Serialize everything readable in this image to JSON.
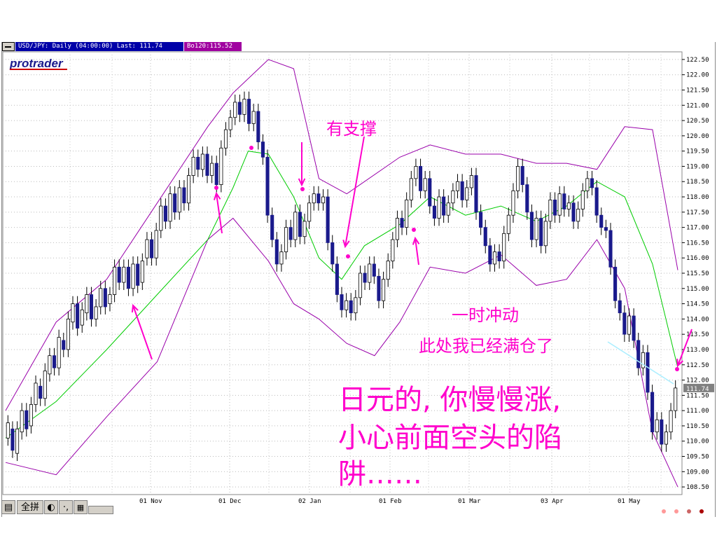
{
  "window": {
    "symbol_info": "USD/JPY: Daily (04:00:00) Last: 111.74",
    "indicator_info": "Bo120:115.52",
    "logo": "protrader",
    "last_price_tag": "111.74"
  },
  "annotations": {
    "support": "有支撑",
    "impulse_line1": "一时冲动",
    "impulse_line2": "此处我已经满仓了",
    "main_line1": "日元的, 你慢慢涨,",
    "main_line2": "小心前面空头的陷",
    "main_line3": "阱……"
  },
  "statusbar": {
    "ime_label": "全拼",
    "moon_icon": "moon-icon",
    "punct_label": "·,",
    "keyboard_icon": "keyboard-icon"
  },
  "colors": {
    "up_candle": "#ffffff",
    "down_candle": "#1a1a8c",
    "middle_band": "#00cc00",
    "outer_bands": "#9900aa",
    "annotation": "#ff00cc",
    "arrow_cyan": "#aaeeff"
  },
  "chart_data": {
    "type": "candlestick",
    "title": "USD/JPY: Daily (04:00:00) Last: 111.74",
    "indicator": "Bollinger Bands (Bo120)",
    "y_ticks": [
      "122.50",
      "122.00",
      "121.50",
      "121.00",
      "120.50",
      "120.00",
      "119.50",
      "119.00",
      "118.50",
      "118.00",
      "117.50",
      "117.00",
      "116.50",
      "116.00",
      "115.50",
      "115.00",
      "114.50",
      "114.00",
      "113.50",
      "113.00",
      "112.50",
      "112.00",
      "111.50",
      "111.00",
      "110.50",
      "110.00",
      "109.50",
      "109.00",
      "108.50"
    ],
    "ylim": [
      108.25,
      122.75
    ],
    "x_ticks": [
      "01 Nov",
      "01 Dec",
      "02 Jan",
      "01 Feb",
      "01 Mar",
      "03 Apr",
      "01 May"
    ],
    "last": 111.74,
    "middle_band": [
      [
        0,
        110.1
      ],
      [
        20,
        111.3
      ],
      [
        40,
        113.0
      ],
      [
        60,
        114.8
      ],
      [
        80,
        116.6
      ],
      [
        90,
        118.3
      ],
      [
        96,
        119.5
      ],
      [
        104,
        119.4
      ],
      [
        114,
        118.0
      ],
      [
        124,
        116.0
      ],
      [
        133,
        115.3
      ],
      [
        142,
        116.4
      ],
      [
        156,
        117.1
      ],
      [
        168,
        118.0
      ],
      [
        182,
        117.4
      ],
      [
        196,
        117.7
      ],
      [
        210,
        117.2
      ],
      [
        222,
        117.7
      ],
      [
        234,
        118.5
      ],
      [
        245,
        118.0
      ],
      [
        256,
        115.8
      ],
      [
        266,
        112.4
      ]
    ],
    "upper_band": [
      [
        0,
        111.0
      ],
      [
        20,
        113.9
      ],
      [
        40,
        115.3
      ],
      [
        60,
        117.8
      ],
      [
        80,
        120.3
      ],
      [
        90,
        121.4
      ],
      [
        104,
        122.5
      ],
      [
        114,
        122.2
      ],
      [
        124,
        118.6
      ],
      [
        135,
        118.1
      ],
      [
        156,
        119.3
      ],
      [
        168,
        119.7
      ],
      [
        182,
        119.4
      ],
      [
        196,
        119.4
      ],
      [
        210,
        119.1
      ],
      [
        222,
        119.1
      ],
      [
        234,
        118.9
      ],
      [
        245,
        120.3
      ],
      [
        256,
        120.2
      ],
      [
        266,
        115.6
      ]
    ],
    "lower_band": [
      [
        0,
        109.3
      ],
      [
        20,
        108.9
      ],
      [
        40,
        110.8
      ],
      [
        60,
        112.6
      ],
      [
        80,
        116.6
      ],
      [
        90,
        117.3
      ],
      [
        104,
        115.9
      ],
      [
        114,
        114.5
      ],
      [
        124,
        114.0
      ],
      [
        135,
        113.2
      ],
      [
        146,
        112.8
      ],
      [
        156,
        113.9
      ],
      [
        168,
        115.7
      ],
      [
        182,
        115.5
      ],
      [
        196,
        116.1
      ],
      [
        210,
        115.1
      ],
      [
        222,
        115.3
      ],
      [
        234,
        116.6
      ],
      [
        245,
        115.0
      ],
      [
        256,
        110.3
      ],
      [
        266,
        108.5
      ]
    ],
    "candles": [
      [
        110.1,
        110.6
      ],
      [
        110.4,
        109.7
      ],
      [
        109.6,
        110.4
      ],
      [
        110.3,
        111.0
      ],
      [
        111.0,
        110.4
      ],
      [
        110.5,
        111.2
      ],
      [
        111.2,
        111.9
      ],
      [
        111.8,
        111.4
      ],
      [
        111.4,
        112.3
      ],
      [
        112.2,
        112.8
      ],
      [
        112.8,
        112.4
      ],
      [
        112.4,
        113.4
      ],
      [
        113.3,
        113.0
      ],
      [
        113.0,
        114.0
      ],
      [
        113.9,
        114.5
      ],
      [
        114.5,
        113.7
      ],
      [
        113.8,
        114.3
      ],
      [
        114.2,
        114.8
      ],
      [
        114.8,
        114.0
      ],
      [
        114.0,
        114.4
      ],
      [
        114.4,
        115.0
      ],
      [
        115.0,
        114.4
      ],
      [
        114.5,
        114.8
      ],
      [
        114.8,
        115.7
      ],
      [
        115.7,
        115.2
      ],
      [
        115.2,
        115.7
      ],
      [
        115.7,
        115.0
      ],
      [
        115.0,
        115.8
      ],
      [
        115.8,
        115.1
      ],
      [
        115.2,
        115.9
      ],
      [
        116.0,
        116.6
      ],
      [
        116.6,
        116.0
      ],
      [
        116.0,
        116.9
      ],
      [
        116.9,
        117.7
      ],
      [
        117.7,
        117.2
      ],
      [
        117.2,
        118.1
      ],
      [
        118.1,
        117.5
      ],
      [
        117.5,
        118.3
      ],
      [
        118.3,
        117.8
      ],
      [
        117.8,
        118.7
      ],
      [
        118.7,
        119.3
      ],
      [
        119.3,
        118.9
      ],
      [
        118.9,
        119.4
      ],
      [
        119.4,
        118.7
      ],
      [
        118.7,
        119.1
      ],
      [
        119.1,
        118.4
      ],
      [
        118.4,
        119.6
      ],
      [
        119.6,
        120.2
      ],
      [
        120.2,
        120.6
      ],
      [
        120.6,
        121.1
      ],
      [
        121.1,
        120.7
      ],
      [
        120.7,
        121.2
      ],
      [
        121.2,
        120.4
      ],
      [
        120.4,
        120.8
      ],
      [
        120.8,
        119.8
      ],
      [
        119.8,
        119.3
      ],
      [
        119.3,
        117.4
      ],
      [
        117.4,
        116.6
      ],
      [
        116.6,
        115.8
      ],
      [
        115.8,
        116.2
      ],
      [
        116.2,
        117.0
      ],
      [
        117.0,
        116.6
      ],
      [
        116.6,
        117.5
      ],
      [
        117.5,
        116.7
      ],
      [
        116.7,
        117.2
      ],
      [
        117.2,
        117.8
      ],
      [
        117.8,
        118.1
      ],
      [
        118.1,
        117.8
      ],
      [
        117.8,
        118.0
      ],
      [
        118.0,
        116.5
      ],
      [
        116.5,
        115.8
      ],
      [
        115.8,
        114.8
      ],
      [
        114.8,
        114.3
      ],
      [
        114.3,
        114.6
      ],
      [
        114.6,
        114.2
      ],
      [
        114.2,
        114.7
      ],
      [
        114.7,
        115.5
      ],
      [
        115.5,
        115.2
      ],
      [
        115.2,
        115.8
      ],
      [
        115.8,
        115.4
      ],
      [
        115.4,
        114.6
      ],
      [
        114.6,
        115.3
      ],
      [
        115.3,
        115.9
      ],
      [
        115.9,
        116.6
      ],
      [
        116.6,
        117.3
      ],
      [
        117.3,
        117.0
      ],
      [
        117.0,
        117.9
      ],
      [
        117.9,
        118.6
      ],
      [
        118.6,
        119.0
      ],
      [
        119.0,
        118.2
      ],
      [
        118.2,
        118.6
      ],
      [
        118.6,
        117.7
      ],
      [
        117.7,
        117.3
      ],
      [
        117.3,
        118.0
      ],
      [
        118.0,
        117.4
      ],
      [
        117.4,
        117.8
      ],
      [
        117.8,
        118.2
      ],
      [
        118.2,
        118.5
      ],
      [
        118.5,
        117.9
      ],
      [
        117.9,
        118.3
      ],
      [
        118.3,
        118.7
      ],
      [
        118.7,
        117.5
      ],
      [
        117.5,
        117.0
      ],
      [
        117.0,
        116.4
      ],
      [
        116.4,
        115.8
      ],
      [
        115.8,
        116.2
      ],
      [
        116.2,
        115.9
      ],
      [
        115.9,
        116.8
      ],
      [
        116.8,
        117.4
      ],
      [
        117.4,
        118.2
      ],
      [
        118.2,
        119.0
      ],
      [
        119.0,
        118.4
      ],
      [
        118.4,
        117.5
      ],
      [
        117.5,
        116.6
      ],
      [
        116.6,
        117.3
      ],
      [
        117.3,
        116.4
      ],
      [
        116.4,
        117.2
      ],
      [
        117.2,
        117.9
      ],
      [
        117.9,
        117.4
      ],
      [
        117.4,
        118.1
      ],
      [
        118.1,
        117.6
      ],
      [
        117.6,
        117.8
      ],
      [
        117.8,
        117.2
      ],
      [
        117.2,
        117.6
      ],
      [
        117.6,
        118.2
      ],
      [
        118.2,
        118.6
      ],
      [
        118.6,
        118.3
      ],
      [
        118.3,
        117.4
      ],
      [
        117.4,
        117.0
      ],
      [
        117.0,
        116.9
      ],
      [
        116.9,
        115.7
      ],
      [
        115.7,
        114.6
      ],
      [
        114.6,
        114.2
      ],
      [
        114.2,
        113.5
      ],
      [
        113.5,
        114.1
      ],
      [
        114.1,
        113.3
      ],
      [
        113.3,
        112.4
      ],
      [
        112.4,
        112.9
      ],
      [
        112.9,
        111.6
      ],
      [
        111.6,
        110.3
      ],
      [
        110.3,
        110.7
      ],
      [
        110.7,
        109.9
      ],
      [
        109.9,
        110.3
      ],
      [
        110.3,
        111.0
      ],
      [
        111.0,
        111.74
      ]
    ]
  }
}
